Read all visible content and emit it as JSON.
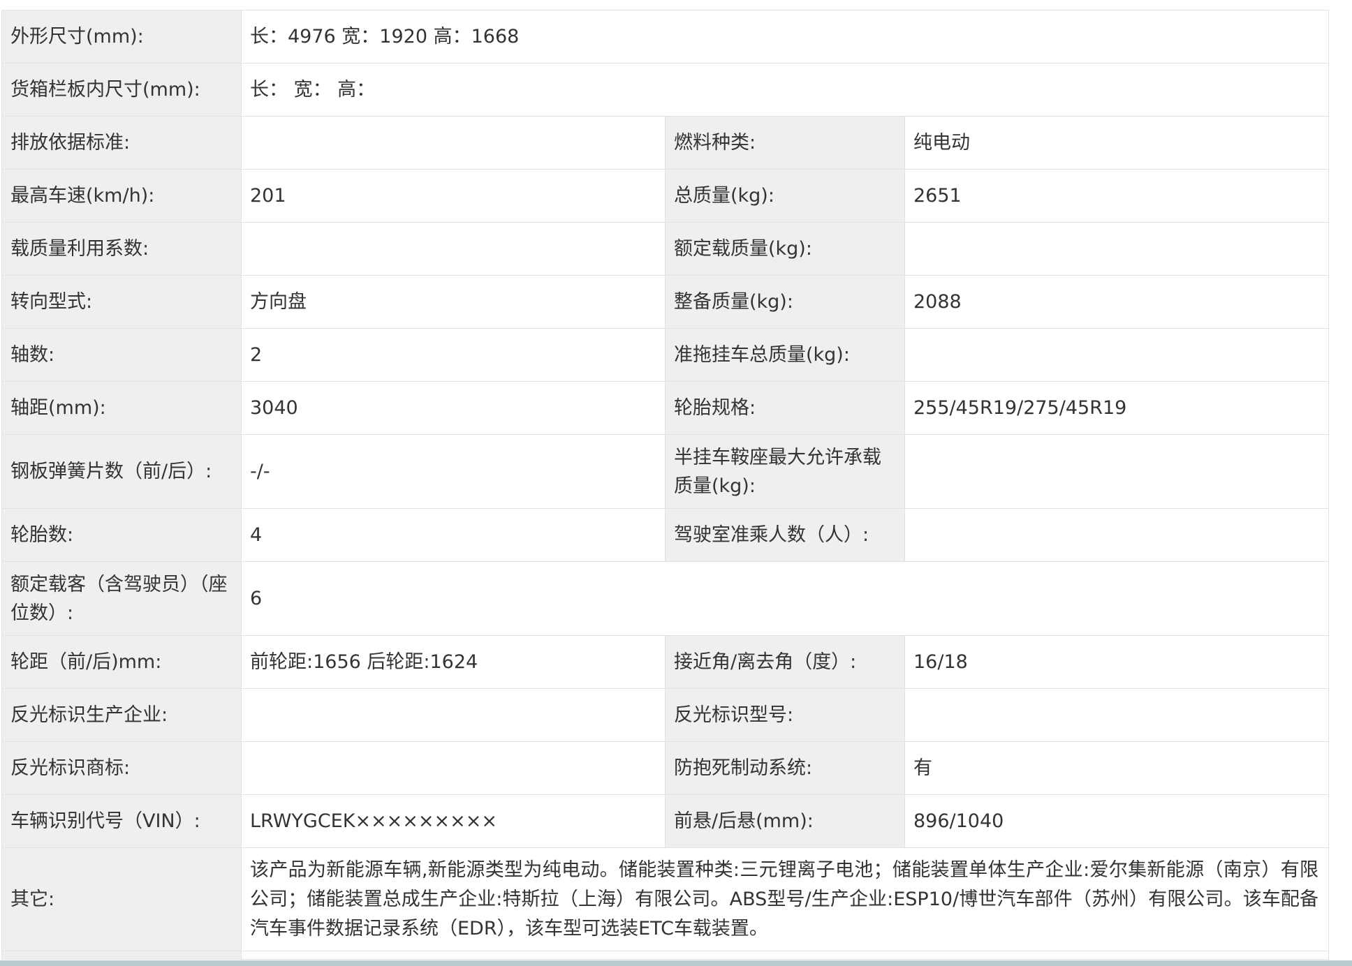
{
  "rows": [
    {
      "label": "外形尺寸(mm):",
      "value": "长：4976 宽：1920 高：1668"
    },
    {
      "label": "货箱栏板内尺寸(mm):",
      "value": "长： 宽： 高："
    },
    {
      "label": "排放依据标准:",
      "value": "",
      "label2": "燃料种类:",
      "value2": "纯电动"
    },
    {
      "label": "最高车速(km/h):",
      "value": "201",
      "label2": "总质量(kg):",
      "value2": "2651"
    },
    {
      "label": "载质量利用系数:",
      "value": "",
      "label2": "额定载质量(kg):",
      "value2": ""
    },
    {
      "label": "转向型式:",
      "value": "方向盘",
      "label2": "整备质量(kg):",
      "value2": "2088"
    },
    {
      "label": "轴数:",
      "value": "2",
      "label2": "准拖挂车总质量(kg):",
      "value2": ""
    },
    {
      "label": "轴距(mm):",
      "value": "3040",
      "label2": "轮胎规格:",
      "value2": "255/45R19/275/45R19"
    },
    {
      "label": "钢板弹簧片数（前/后）:",
      "value": "-/-",
      "label2": "半挂车鞍座最大允许承载质量(kg):",
      "value2": ""
    },
    {
      "label": "轮胎数:",
      "value": "4",
      "label2": "驾驶室准乘人数（人）:",
      "value2": ""
    },
    {
      "label": "额定载客（含驾驶员）（座位数）:",
      "value": "6"
    },
    {
      "label": "轮距（前/后)mm:",
      "value": "前轮距:1656 后轮距:1624",
      "label2": "接近角/离去角（度）:",
      "value2": "16/18"
    },
    {
      "label": "反光标识生产企业:",
      "value": "",
      "label2": "反光标识型号:",
      "value2": ""
    },
    {
      "label": "反光标识商标:",
      "value": "",
      "label2": "防抱死制动系统:",
      "value2": "有"
    },
    {
      "label": "车辆识别代号（VIN）:",
      "value": "LRWYGCEK×××××××××",
      "label2": "前悬/后悬(mm):",
      "value2": "896/1040"
    },
    {
      "label": "其它:",
      "value": "该产品为新能源车辆,新能源类型为纯电动。储能装置种类:三元锂离子电池；储能装置单体生产企业:爱尔集新能源（南京）有限公司；储能装置总成生产企业:特斯拉（上海）有限公司。ABS型号/生产企业:ESP10/博世汽车部件（苏州）有限公司。该车配备汽车事件数据记录系统（EDR），该车型可选装ETC车载装置。"
    }
  ]
}
